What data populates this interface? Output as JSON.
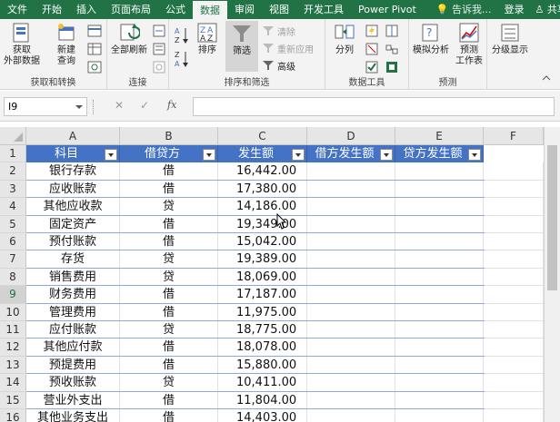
{
  "menu": {
    "tabs": [
      "文件",
      "开始",
      "插入",
      "页面布局",
      "公式",
      "数据",
      "审阅",
      "视图",
      "开发工具",
      "Power Pivot"
    ],
    "active": "数据",
    "tell_me": "告诉我...",
    "login": "登录",
    "share": "共享"
  },
  "ribbon": {
    "groups": {
      "get_transform": "获取和转换",
      "connections": "连接",
      "sort_filter": "排序和筛选",
      "data_tools": "数据工具",
      "forecast": "预测",
      "outline": "分级显示"
    },
    "buttons": {
      "get_external": "获取\n外部数据",
      "new_query": "新建\n查询",
      "refresh_all": "全部刷新",
      "sort": "排序",
      "filter": "筛选",
      "clear": "清除",
      "reapply": "重新应用",
      "advanced": "高级",
      "split": "分列",
      "what_if": "模拟分析",
      "forecast_sheet": "预测\n工作表",
      "outline": "分级显示"
    }
  },
  "formula_bar": {
    "name_box": "I9",
    "fx": "fx",
    "value": ""
  },
  "sheet": {
    "columns": [
      "A",
      "B",
      "C",
      "D",
      "E",
      "F"
    ],
    "rows": [
      "1",
      "2",
      "3",
      "4",
      "5",
      "6",
      "7",
      "8",
      "9",
      "10",
      "11",
      "12",
      "13",
      "14",
      "15",
      "16"
    ],
    "selected_row": "9",
    "headers": [
      "科目",
      "借贷方",
      "发生额",
      "借方发生额",
      "贷方发生额"
    ],
    "data": [
      [
        "银行存款",
        "借",
        "16,442.00"
      ],
      [
        "应收账款",
        "借",
        "17,380.00"
      ],
      [
        "其他应收款",
        "贷",
        "14,186.00"
      ],
      [
        "固定资产",
        "借",
        "19,349.00"
      ],
      [
        "预付账款",
        "借",
        "15,042.00"
      ],
      [
        "存货",
        "贷",
        "19,389.00"
      ],
      [
        "销售费用",
        "贷",
        "18,069.00"
      ],
      [
        "财务费用",
        "借",
        "17,187.00"
      ],
      [
        "管理费用",
        "借",
        "11,975.00"
      ],
      [
        "应付账款",
        "贷",
        "18,775.00"
      ],
      [
        "其他应付款",
        "借",
        "18,078.00"
      ],
      [
        "预提费用",
        "借",
        "15,880.00"
      ],
      [
        "预收账款",
        "贷",
        "10,411.00"
      ],
      [
        "营业外支出",
        "借",
        "11,804.00"
      ],
      [
        "其他业务支出",
        "借",
        "14,403.00"
      ]
    ]
  },
  "colors": {
    "excel_green": "#217346",
    "table_header": "#4472c4",
    "band_line": "#8eaadb"
  }
}
